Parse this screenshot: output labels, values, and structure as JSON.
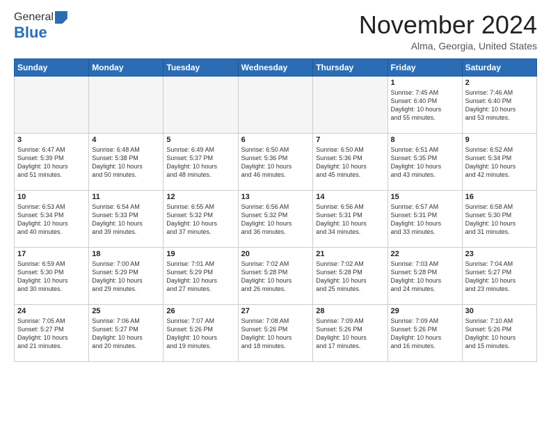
{
  "logo": {
    "general": "General",
    "blue": "Blue"
  },
  "title": "November 2024",
  "location": "Alma, Georgia, United States",
  "headers": [
    "Sunday",
    "Monday",
    "Tuesday",
    "Wednesday",
    "Thursday",
    "Friday",
    "Saturday"
  ],
  "weeks": [
    [
      {
        "day": "",
        "info": ""
      },
      {
        "day": "",
        "info": ""
      },
      {
        "day": "",
        "info": ""
      },
      {
        "day": "",
        "info": ""
      },
      {
        "day": "",
        "info": ""
      },
      {
        "day": "1",
        "info": "Sunrise: 7:45 AM\nSunset: 6:40 PM\nDaylight: 10 hours\nand 55 minutes."
      },
      {
        "day": "2",
        "info": "Sunrise: 7:46 AM\nSunset: 6:40 PM\nDaylight: 10 hours\nand 53 minutes."
      }
    ],
    [
      {
        "day": "3",
        "info": "Sunrise: 6:47 AM\nSunset: 5:39 PM\nDaylight: 10 hours\nand 51 minutes."
      },
      {
        "day": "4",
        "info": "Sunrise: 6:48 AM\nSunset: 5:38 PM\nDaylight: 10 hours\nand 50 minutes."
      },
      {
        "day": "5",
        "info": "Sunrise: 6:49 AM\nSunset: 5:37 PM\nDaylight: 10 hours\nand 48 minutes."
      },
      {
        "day": "6",
        "info": "Sunrise: 6:50 AM\nSunset: 5:36 PM\nDaylight: 10 hours\nand 46 minutes."
      },
      {
        "day": "7",
        "info": "Sunrise: 6:50 AM\nSunset: 5:36 PM\nDaylight: 10 hours\nand 45 minutes."
      },
      {
        "day": "8",
        "info": "Sunrise: 6:51 AM\nSunset: 5:35 PM\nDaylight: 10 hours\nand 43 minutes."
      },
      {
        "day": "9",
        "info": "Sunrise: 6:52 AM\nSunset: 5:34 PM\nDaylight: 10 hours\nand 42 minutes."
      }
    ],
    [
      {
        "day": "10",
        "info": "Sunrise: 6:53 AM\nSunset: 5:34 PM\nDaylight: 10 hours\nand 40 minutes."
      },
      {
        "day": "11",
        "info": "Sunrise: 6:54 AM\nSunset: 5:33 PM\nDaylight: 10 hours\nand 39 minutes."
      },
      {
        "day": "12",
        "info": "Sunrise: 6:55 AM\nSunset: 5:32 PM\nDaylight: 10 hours\nand 37 minutes."
      },
      {
        "day": "13",
        "info": "Sunrise: 6:56 AM\nSunset: 5:32 PM\nDaylight: 10 hours\nand 36 minutes."
      },
      {
        "day": "14",
        "info": "Sunrise: 6:56 AM\nSunset: 5:31 PM\nDaylight: 10 hours\nand 34 minutes."
      },
      {
        "day": "15",
        "info": "Sunrise: 6:57 AM\nSunset: 5:31 PM\nDaylight: 10 hours\nand 33 minutes."
      },
      {
        "day": "16",
        "info": "Sunrise: 6:58 AM\nSunset: 5:30 PM\nDaylight: 10 hours\nand 31 minutes."
      }
    ],
    [
      {
        "day": "17",
        "info": "Sunrise: 6:59 AM\nSunset: 5:30 PM\nDaylight: 10 hours\nand 30 minutes."
      },
      {
        "day": "18",
        "info": "Sunrise: 7:00 AM\nSunset: 5:29 PM\nDaylight: 10 hours\nand 29 minutes."
      },
      {
        "day": "19",
        "info": "Sunrise: 7:01 AM\nSunset: 5:29 PM\nDaylight: 10 hours\nand 27 minutes."
      },
      {
        "day": "20",
        "info": "Sunrise: 7:02 AM\nSunset: 5:28 PM\nDaylight: 10 hours\nand 26 minutes."
      },
      {
        "day": "21",
        "info": "Sunrise: 7:02 AM\nSunset: 5:28 PM\nDaylight: 10 hours\nand 25 minutes."
      },
      {
        "day": "22",
        "info": "Sunrise: 7:03 AM\nSunset: 5:28 PM\nDaylight: 10 hours\nand 24 minutes."
      },
      {
        "day": "23",
        "info": "Sunrise: 7:04 AM\nSunset: 5:27 PM\nDaylight: 10 hours\nand 23 minutes."
      }
    ],
    [
      {
        "day": "24",
        "info": "Sunrise: 7:05 AM\nSunset: 5:27 PM\nDaylight: 10 hours\nand 21 minutes."
      },
      {
        "day": "25",
        "info": "Sunrise: 7:06 AM\nSunset: 5:27 PM\nDaylight: 10 hours\nand 20 minutes."
      },
      {
        "day": "26",
        "info": "Sunrise: 7:07 AM\nSunset: 5:26 PM\nDaylight: 10 hours\nand 19 minutes."
      },
      {
        "day": "27",
        "info": "Sunrise: 7:08 AM\nSunset: 5:26 PM\nDaylight: 10 hours\nand 18 minutes."
      },
      {
        "day": "28",
        "info": "Sunrise: 7:09 AM\nSunset: 5:26 PM\nDaylight: 10 hours\nand 17 minutes."
      },
      {
        "day": "29",
        "info": "Sunrise: 7:09 AM\nSunset: 5:26 PM\nDaylight: 10 hours\nand 16 minutes."
      },
      {
        "day": "30",
        "info": "Sunrise: 7:10 AM\nSunset: 5:26 PM\nDaylight: 10 hours\nand 15 minutes."
      }
    ]
  ]
}
